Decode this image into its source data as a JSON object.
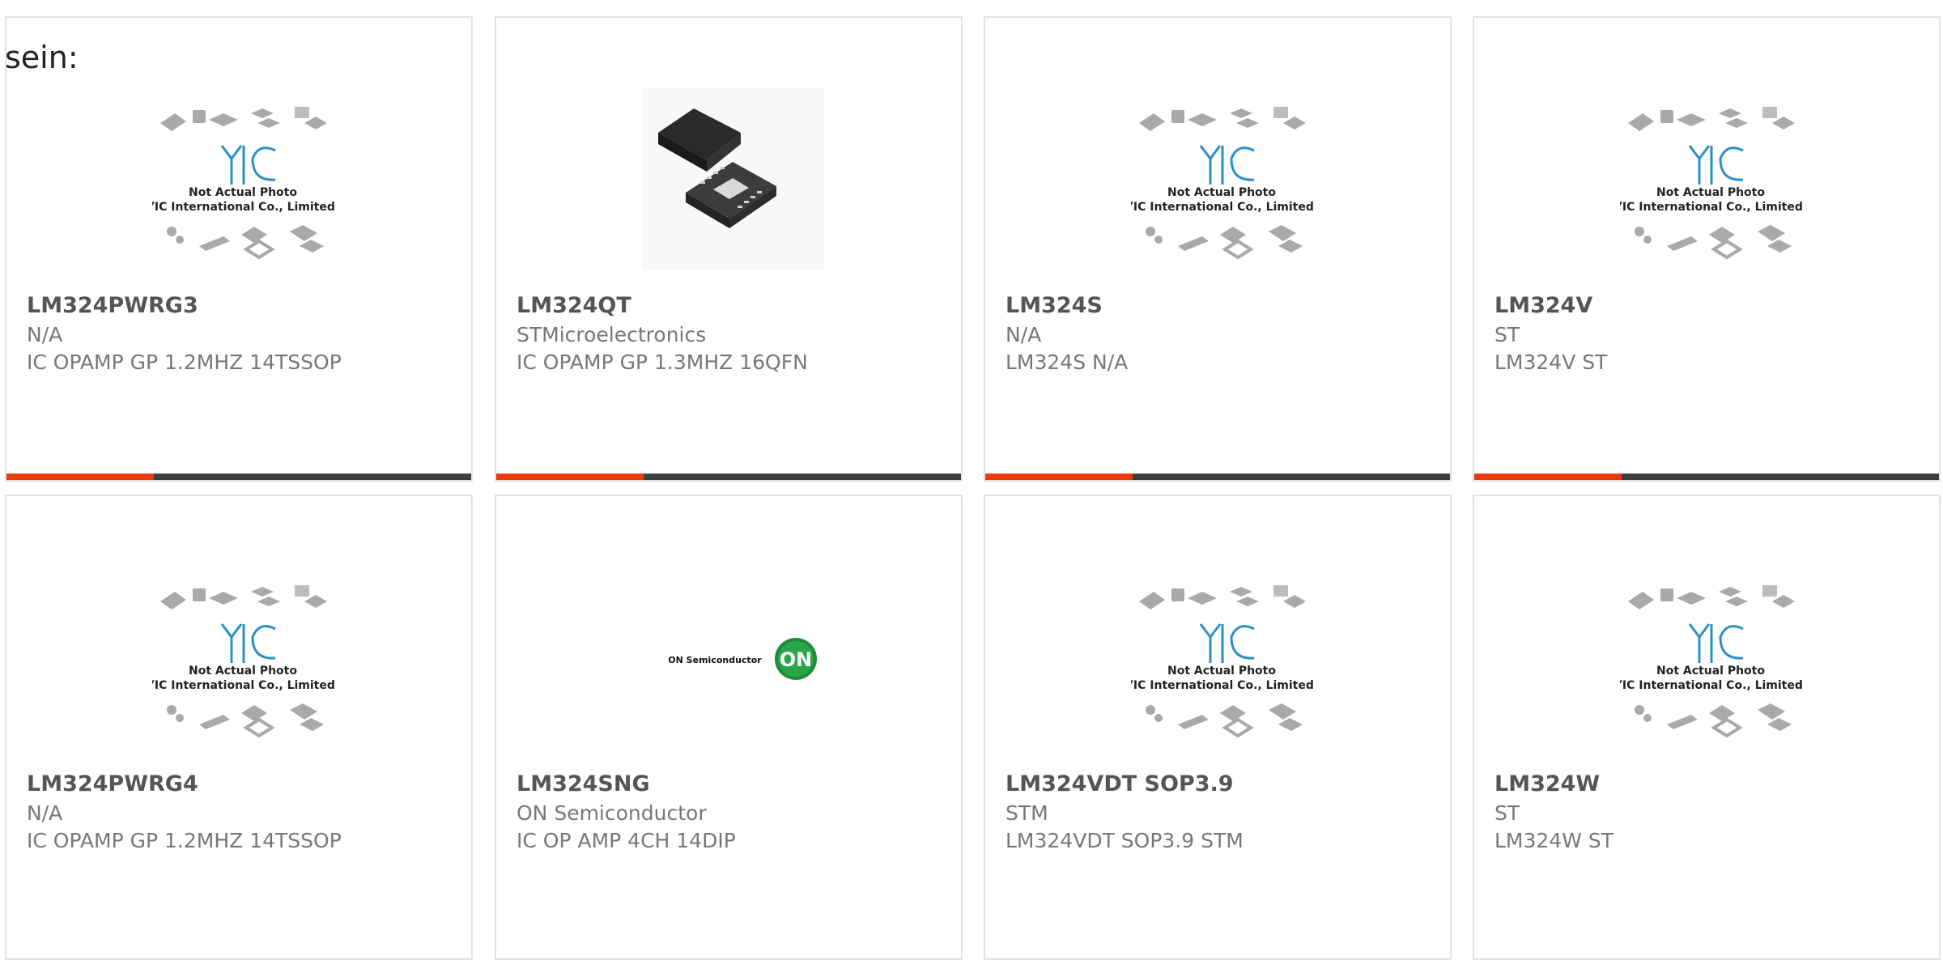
{
  "intro_text": "sein:",
  "yic_placeholder": {
    "line1": "Not Actual Photo",
    "line2": "YIC International Co., Limited.",
    "logo_text": "YIC"
  },
  "on_logo": {
    "brand": "ON Semiconductor",
    "mark": "ON"
  },
  "products": [
    {
      "part": "LM324PWRG3",
      "maker": "N/A",
      "desc": "IC OPAMP GP 1.2MHZ 14TSSOP",
      "image": "yic-placeholder"
    },
    {
      "part": "LM324QT",
      "maker": "STMicroelectronics",
      "desc": "IC OPAMP GP 1.3MHZ 16QFN",
      "image": "qfn-chip-photo"
    },
    {
      "part": "LM324S",
      "maker": "N/A",
      "desc": "LM324S N/A",
      "image": "yic-placeholder"
    },
    {
      "part": "LM324V",
      "maker": "ST",
      "desc": "LM324V ST",
      "image": "yic-placeholder"
    },
    {
      "part": "LM324PWRG4",
      "maker": "N/A",
      "desc": "IC OPAMP GP 1.2MHZ 14TSSOP",
      "image": "yic-placeholder"
    },
    {
      "part": "LM324SNG",
      "maker": "ON Semiconductor",
      "desc": "IC OP AMP 4CH 14DIP",
      "image": "on-semiconductor-logo"
    },
    {
      "part": "LM324VDT SOP3.9",
      "maker": "STM",
      "desc": "LM324VDT SOP3.9 STM",
      "image": "yic-placeholder"
    },
    {
      "part": "LM324W",
      "maker": "ST",
      "desc": "LM324W ST",
      "image": "yic-placeholder"
    }
  ],
  "colors": {
    "accent": "#ee3a0a",
    "bar": "#3d3d3d",
    "title": "#555555",
    "text": "#777777",
    "yic_blue": "#2a8fc8"
  }
}
